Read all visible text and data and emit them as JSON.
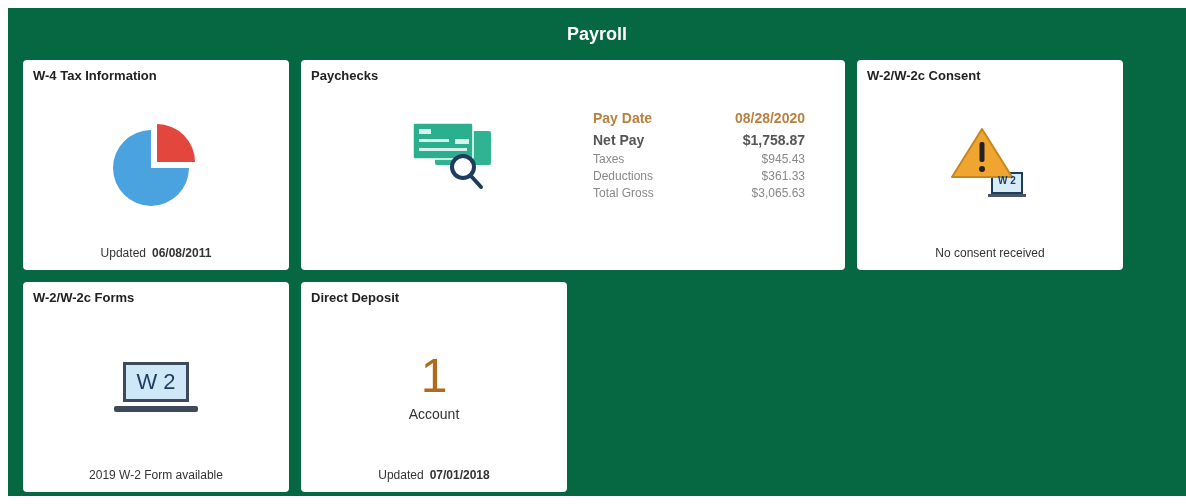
{
  "header": {
    "title": "Payroll"
  },
  "tiles": [
    {
      "kind": "tax",
      "title": "W-4 Tax Information",
      "footer_label": "Updated",
      "footer_value": "06/08/2011"
    },
    {
      "kind": "paychecks",
      "title": "Paychecks",
      "rows": [
        {
          "label": "Pay Date",
          "value": "08/28/2020",
          "kind": "highlight"
        },
        {
          "label": "Net Pay",
          "value": "$1,758.87",
          "kind": "strong"
        },
        {
          "label": "Taxes",
          "value": "$945.43",
          "kind": "plain"
        },
        {
          "label": "Deductions",
          "value": "$361.33",
          "kind": "plain"
        },
        {
          "label": "Total Gross",
          "value": "$3,065.63",
          "kind": "plain"
        }
      ]
    },
    {
      "kind": "consent",
      "title": "W-2/W-2c Consent",
      "icon_text": "W 2",
      "footer_label": "No consent received"
    },
    {
      "kind": "forms",
      "title": "W-2/W-2c Forms",
      "icon_text": "W 2",
      "footer_label": "2019 W-2 Form available"
    },
    {
      "kind": "count",
      "title": "Direct Deposit",
      "count": "1",
      "count_label": "Account",
      "footer_label": "Updated",
      "footer_value": "07/01/2018"
    }
  ]
}
